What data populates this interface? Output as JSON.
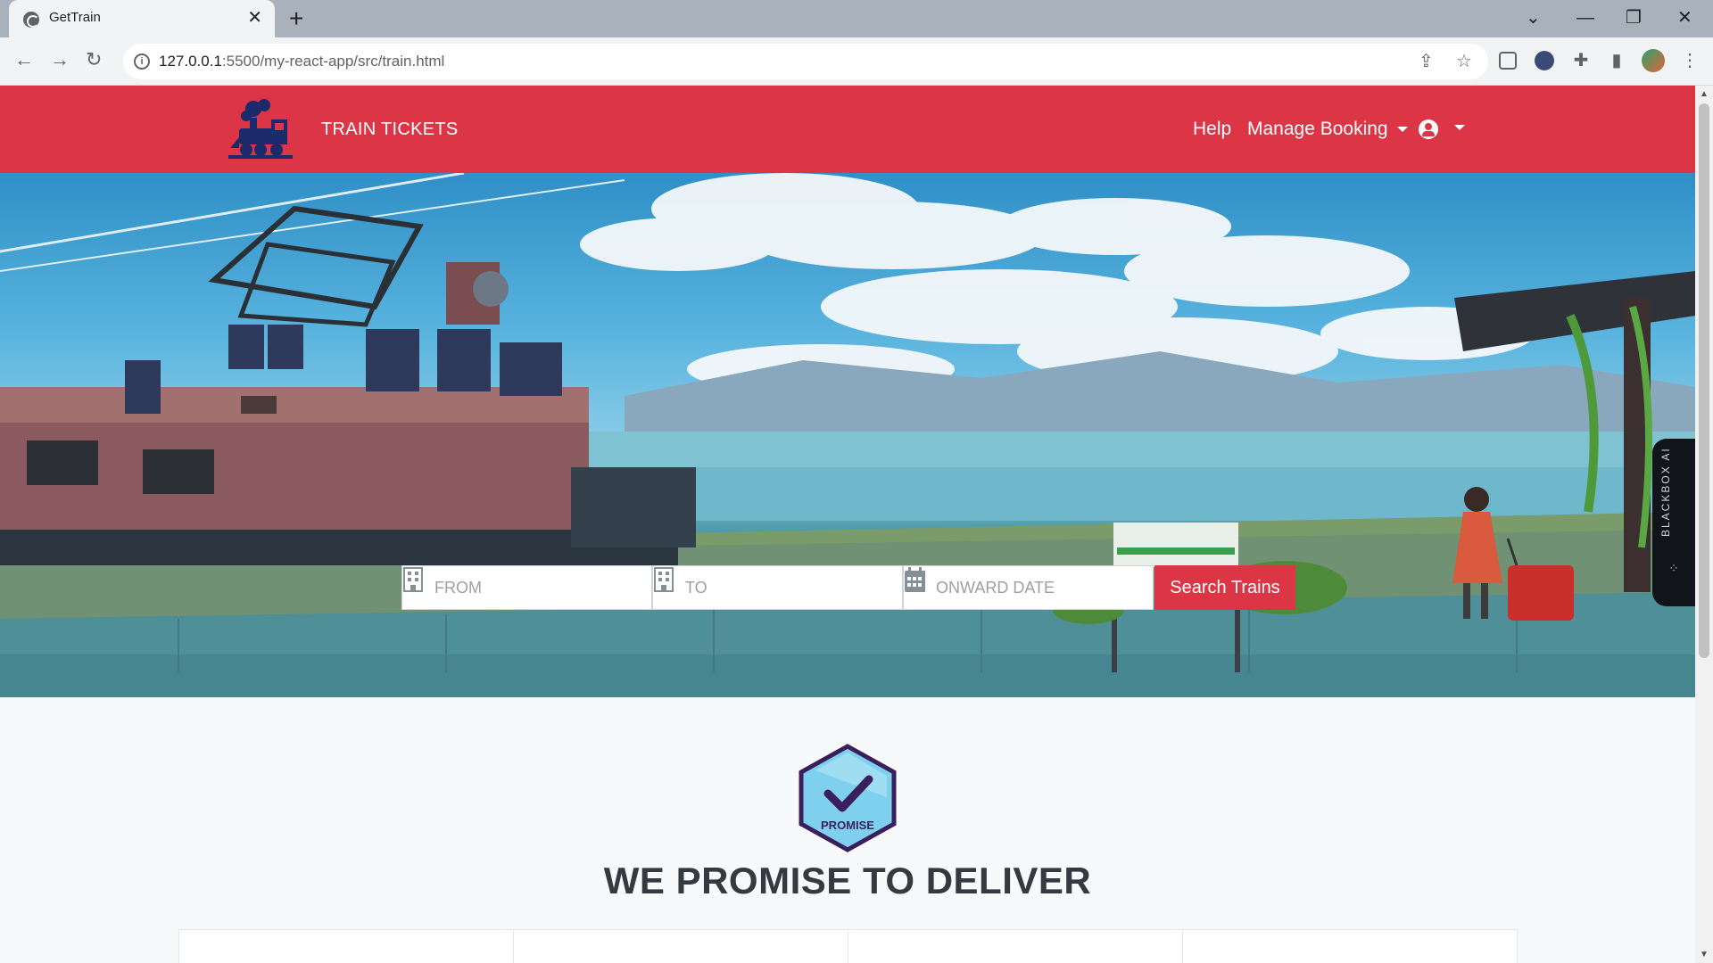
{
  "browser": {
    "tab_title": "GetTrain",
    "tab_close": "✕",
    "new_tab": "+",
    "url_host": "127.0.0.1",
    "url_rest": ":5500/my-react-app/src/train.html",
    "controls": {
      "chevron": "⌄",
      "minimize": "—",
      "restore": "❐",
      "close": "✕"
    },
    "nav": {
      "back": "←",
      "forward": "→",
      "reload": "↻"
    },
    "omni_icons": {
      "share": "⇪",
      "star": "☆"
    },
    "ext_icons": {
      "puzzle": "✚",
      "panel": "▮",
      "menu": "⋮"
    }
  },
  "navbar": {
    "brand": "TRAIN TICKETS",
    "help": "Help",
    "manage_booking": "Manage Booking"
  },
  "search": {
    "from_placeholder": "FROM",
    "to_placeholder": "TO",
    "date_placeholder": "ONWARD DATE",
    "button_label": "Search Trains"
  },
  "widget": {
    "label": "BLACKBOX AI",
    "dots": "⁘"
  },
  "promise": {
    "badge_text": "PROMISE",
    "heading": "WE PROMISE TO DELIVER"
  },
  "colors": {
    "primary": "#dc3545",
    "heading": "#343a40",
    "badge_fill": "#7fd0ee",
    "badge_stroke": "#3b1f5c"
  }
}
